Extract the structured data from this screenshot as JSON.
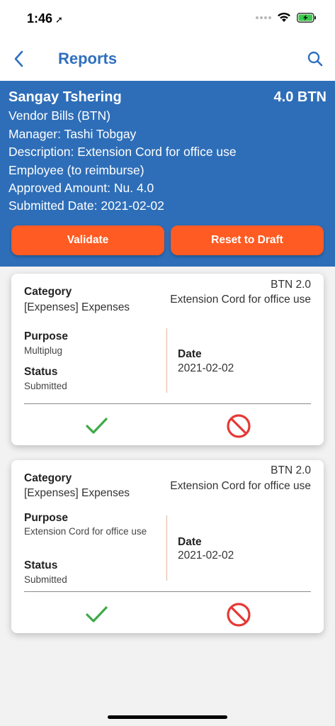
{
  "status_bar": {
    "time": "1:46",
    "location_glyph": "➚"
  },
  "nav": {
    "title": "Reports"
  },
  "report": {
    "employee": "Sangay Tshering",
    "total": "4.0 BTN",
    "journal": "Vendor Bills (BTN)",
    "manager": "Manager: Tashi Tobgay",
    "description": "Description: Extension Cord for office use",
    "payment_mode": "Employee (to reimburse)",
    "approved_amount": "Approved Amount: Nu. 4.0",
    "submitted_date": "Submitted Date: 2021-02-02"
  },
  "actions": {
    "validate_label": "Validate",
    "reset_label": "Reset to Draft"
  },
  "labels": {
    "category": "Category",
    "purpose": "Purpose",
    "status": "Status",
    "date": "Date"
  },
  "lines": [
    {
      "amount": "BTN 2.0",
      "description": "Extension Cord for office use",
      "category": "[Expenses] Expenses",
      "purpose": "Multiplug",
      "status": "Submitted",
      "date": "2021-02-02"
    },
    {
      "amount": "BTN 2.0",
      "description": "Extension Cord for office use",
      "category": "[Expenses] Expenses",
      "purpose": "Extension Cord for office use",
      "status": "Submitted",
      "date": "2021-02-02"
    }
  ],
  "colors": {
    "primary": "#2e6eb8",
    "accent": "#ff5b22",
    "approve": "#3daa47",
    "reject": "#e53935"
  },
  "icons": {
    "back": "chevron-left-icon",
    "search": "search-icon",
    "approve": "check-icon",
    "reject": "ban-icon"
  }
}
